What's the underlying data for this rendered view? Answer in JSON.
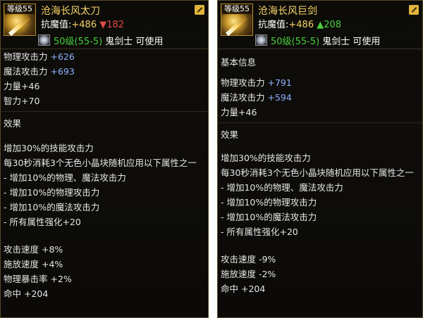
{
  "left": {
    "level": "等级55",
    "name": "沧海长风太刀",
    "resist_label": "抗魔值:",
    "resist_base": "+486",
    "resist_delta": "▼182",
    "req_level": "50级(55-5)",
    "req_class": "鬼剑士 可使用",
    "stats": [
      {
        "label": "物理攻击力",
        "value": "+626"
      },
      {
        "label": "魔法攻击力",
        "value": "+693"
      },
      {
        "label": "力量",
        "value": "+46"
      },
      {
        "label": "智力",
        "value": "+70"
      }
    ],
    "effect_title": "效果",
    "effects": [
      "增加30%的技能攻击力",
      "每30秒消耗3个无色小晶块随机应用以下属性之一",
      "- 增加10%的物理、魔法攻击力",
      "- 增加10%的物理攻击力",
      "- 增加10%的魔法攻击力",
      "- 所有属性强化+20"
    ],
    "extras": [
      "攻击速度 +8%",
      "施放速度 +4%",
      "物理暴击率 +2%",
      "命中 +204"
    ]
  },
  "right": {
    "level": "等级55",
    "name": "沧海长风巨剑",
    "resist_label": "抗魔值:",
    "resist_base": "+486",
    "resist_delta": "▲208",
    "req_level": "50级(55-5)",
    "req_class": "鬼剑士 可使用",
    "basic_title": "基本信息",
    "stats": [
      {
        "label": "物理攻击力",
        "value": "+791"
      },
      {
        "label": "魔法攻击力",
        "value": "+594"
      },
      {
        "label": "力量",
        "value": "+46"
      }
    ],
    "effect_title": "效果",
    "effects": [
      "增加30%的技能攻击力",
      "每30秒消耗3个无色小晶块随机应用以下属性之一",
      "- 增加10%的物理、魔法攻击力",
      "- 增加10%的物理攻击力",
      "- 增加10%的魔法攻击力",
      "- 所有属性强化+20"
    ],
    "extras": [
      "攻击速度 -9%",
      "施放速度 -2%",
      "命中 +204"
    ]
  },
  "colors": {
    "title": "#f6d36a",
    "stat_value": "#8fb0ff",
    "down": "#e24a4a",
    "up": "#48d03c"
  },
  "icons": [
    "weapon-katana-icon",
    "weapon-greatsword-icon",
    "edit-icon",
    "ring-icon"
  ]
}
